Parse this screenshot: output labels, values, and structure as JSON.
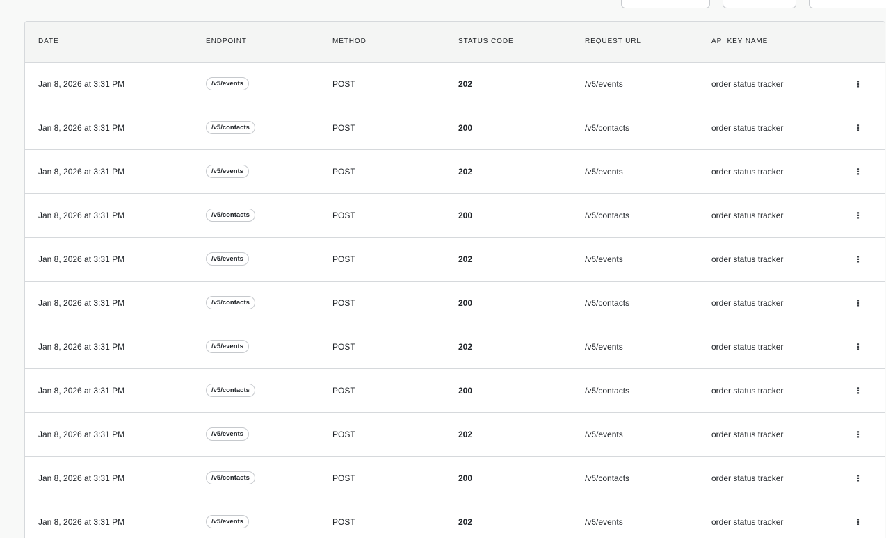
{
  "table": {
    "headers": {
      "date": "DATE",
      "endpoint": "ENDPOINT",
      "method": "METHOD",
      "status_code": "STATUS CODE",
      "request_url": "REQUEST URL",
      "api_key_name": "API KEY NAME"
    },
    "rows": [
      {
        "date": "Jan 8, 2026 at 3:31 PM",
        "endpoint": "/v5/events",
        "method": "POST",
        "status_code": "202",
        "request_url": "/v5/events",
        "api_key_name": "order status tracker"
      },
      {
        "date": "Jan 8, 2026 at 3:31 PM",
        "endpoint": "/v5/contacts",
        "method": "POST",
        "status_code": "200",
        "request_url": "/v5/contacts",
        "api_key_name": "order status tracker"
      },
      {
        "date": "Jan 8, 2026 at 3:31 PM",
        "endpoint": "/v5/events",
        "method": "POST",
        "status_code": "202",
        "request_url": "/v5/events",
        "api_key_name": "order status tracker"
      },
      {
        "date": "Jan 8, 2026 at 3:31 PM",
        "endpoint": "/v5/contacts",
        "method": "POST",
        "status_code": "200",
        "request_url": "/v5/contacts",
        "api_key_name": "order status tracker"
      },
      {
        "date": "Jan 8, 2026 at 3:31 PM",
        "endpoint": "/v5/events",
        "method": "POST",
        "status_code": "202",
        "request_url": "/v5/events",
        "api_key_name": "order status tracker"
      },
      {
        "date": "Jan 8, 2026 at 3:31 PM",
        "endpoint": "/v5/contacts",
        "method": "POST",
        "status_code": "200",
        "request_url": "/v5/contacts",
        "api_key_name": "order status tracker"
      },
      {
        "date": "Jan 8, 2026 at 3:31 PM",
        "endpoint": "/v5/events",
        "method": "POST",
        "status_code": "202",
        "request_url": "/v5/events",
        "api_key_name": "order status tracker"
      },
      {
        "date": "Jan 8, 2026 at 3:31 PM",
        "endpoint": "/v5/contacts",
        "method": "POST",
        "status_code": "200",
        "request_url": "/v5/contacts",
        "api_key_name": "order status tracker"
      },
      {
        "date": "Jan 8, 2026 at 3:31 PM",
        "endpoint": "/v5/events",
        "method": "POST",
        "status_code": "202",
        "request_url": "/v5/events",
        "api_key_name": "order status tracker"
      },
      {
        "date": "Jan 8, 2026 at 3:31 PM",
        "endpoint": "/v5/contacts",
        "method": "POST",
        "status_code": "200",
        "request_url": "/v5/contacts",
        "api_key_name": "order status tracker"
      },
      {
        "date": "Jan 8, 2026 at 3:31 PM",
        "endpoint": "/v5/events",
        "method": "POST",
        "status_code": "202",
        "request_url": "/v5/events",
        "api_key_name": "order status tracker"
      }
    ],
    "row_action_icon": "kebab-menu-icon"
  },
  "colors": {
    "page_background": "#f8f9f8",
    "header_background": "#f4f5f4",
    "border": "#d6d9dc"
  }
}
